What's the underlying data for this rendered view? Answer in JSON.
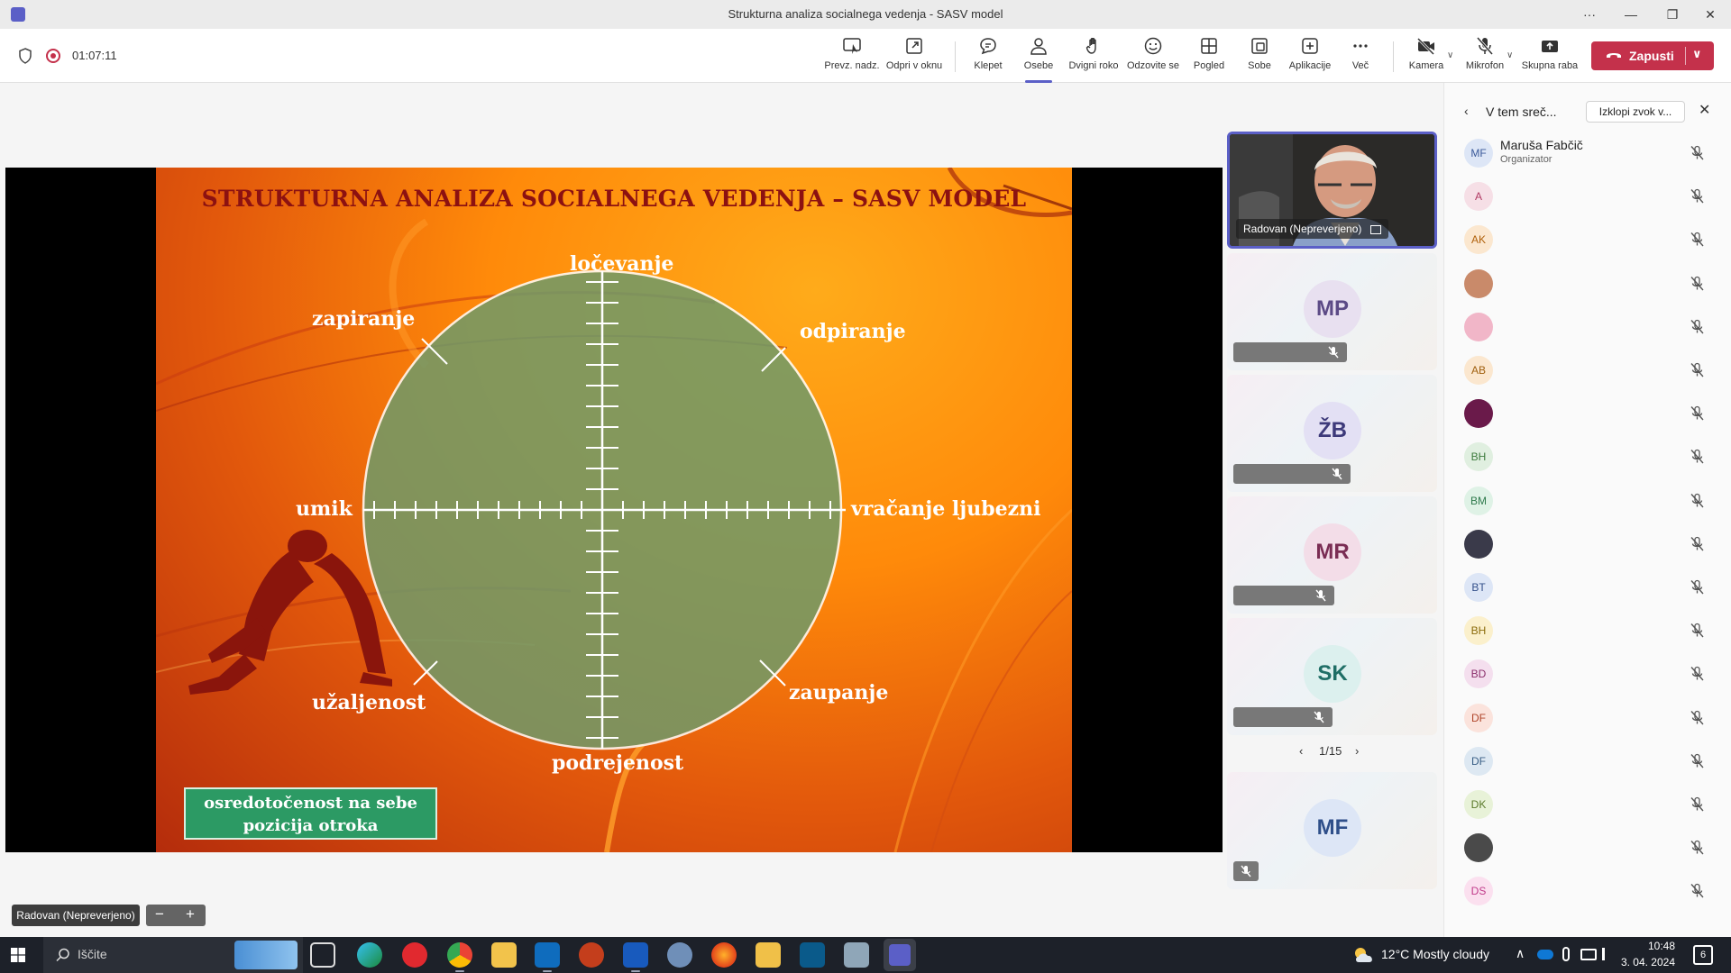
{
  "window": {
    "title": "Strukturna analiza socialnega vedenja - SASV model",
    "more": "···",
    "minimize": "—",
    "restore": "❐",
    "close": "✕"
  },
  "toolbar": {
    "timer": "01:07:11",
    "buttons": [
      {
        "label": "Prevz. nadz.",
        "icon": "take-control-icon"
      },
      {
        "label": "Odpri v oknu",
        "icon": "popout-icon"
      },
      {
        "label": "Klepet",
        "icon": "chat-icon"
      },
      {
        "label": "Osebe",
        "icon": "people-icon"
      },
      {
        "label": "Dvigni roko",
        "icon": "raise-hand-icon"
      },
      {
        "label": "Odzovite se",
        "icon": "react-icon"
      },
      {
        "label": "Pogled",
        "icon": "view-icon"
      },
      {
        "label": "Sobe",
        "icon": "rooms-icon"
      },
      {
        "label": "Aplikacije",
        "icon": "apps-icon"
      },
      {
        "label": "Več",
        "icon": "more-icon"
      },
      {
        "label": "Kamera",
        "icon": "camera-off-icon"
      },
      {
        "label": "Mikrofon",
        "icon": "mic-off-icon"
      },
      {
        "label": "Skupna raba",
        "icon": "share-icon"
      }
    ],
    "leave_label": "Zapusti",
    "accent_color": "#5b5fc7",
    "leave_color": "#c4314b"
  },
  "slide": {
    "title": "STRUKTURNA ANALIZA SOCIALNEGA VEDENJA – SASV MODEL",
    "labels": {
      "top": "ločevanje",
      "top_left": "zapiranje",
      "top_right": "odpiranje",
      "left": "umik",
      "right": "vračanje ljubezni",
      "bottom_left": "užaljenost",
      "bottom_right": "zaupanje",
      "bottom": "podrejenost"
    },
    "box_line1": "osredotočenost na sebe",
    "box_line2": "pozicija otroka"
  },
  "presenter": {
    "label": "Radovan (Nepreverjeno)",
    "zoom_out": "−",
    "zoom_in": "+"
  },
  "tiles": [
    {
      "type": "video",
      "name": "Radovan (Nepreverjeno)"
    },
    {
      "type": "avatar",
      "initials": "MP",
      "bg": "#e8e0f0",
      "fg": "#5c4a86"
    },
    {
      "type": "avatar",
      "initials": "ŽB",
      "bg": "#e3e0f4",
      "fg": "#3d3a7a"
    },
    {
      "type": "avatar",
      "initials": "MR",
      "bg": "#f3dde8",
      "fg": "#7a2d54"
    },
    {
      "type": "avatar",
      "initials": "SK",
      "bg": "#dcf0ee",
      "fg": "#1f6e66"
    },
    {
      "type": "avatar",
      "initials": "MF",
      "bg": "#dde6f6",
      "fg": "#2f4f8a"
    }
  ],
  "pager": {
    "text": "1/15",
    "prev": "‹",
    "next": "›"
  },
  "panel": {
    "title": "V tem sreč...",
    "mute_all": "Izklopi zvok v...",
    "back": "‹",
    "close": "✕",
    "participants": [
      {
        "initials": "MF",
        "name": "Maruša Fabčič",
        "role": "Organizator",
        "bg": "#dde6f6",
        "fg": "#3a5a9a"
      },
      {
        "initials": "A",
        "name": "",
        "role": "",
        "bg": "#f6dfe6",
        "fg": "#b03a63"
      },
      {
        "initials": "AK",
        "name": "",
        "role": "",
        "bg": "#fbe7cf",
        "fg": "#b0610b"
      },
      {
        "initials": "",
        "name": "",
        "role": "",
        "bg": "#c98a6a",
        "fg": "#fff",
        "photo": true
      },
      {
        "initials": "",
        "name": "",
        "role": "",
        "bg": "#f1b6c8",
        "fg": "#fff",
        "photo": true
      },
      {
        "initials": "AB",
        "name": "",
        "role": "",
        "bg": "#fbe7cf",
        "fg": "#a0600f"
      },
      {
        "initials": "",
        "name": "",
        "role": "",
        "bg": "#6a1a4a",
        "fg": "#fff",
        "photo": true
      },
      {
        "initials": "BH",
        "name": "",
        "role": "",
        "bg": "#e0efe0",
        "fg": "#3c7a3c"
      },
      {
        "initials": "BM",
        "name": "",
        "role": "",
        "bg": "#dff2e6",
        "fg": "#2e7a4c"
      },
      {
        "initials": "",
        "name": "",
        "role": "",
        "bg": "#3a3a4a",
        "fg": "#fff",
        "photo": true
      },
      {
        "initials": "BT",
        "name": "",
        "role": "",
        "bg": "#dde6f6",
        "fg": "#34508a"
      },
      {
        "initials": "BH",
        "name": "",
        "role": "",
        "bg": "#fbf0cc",
        "fg": "#8a6a0a"
      },
      {
        "initials": "BD",
        "name": "",
        "role": "",
        "bg": "#f4dfee",
        "fg": "#8a2d6a"
      },
      {
        "initials": "DF",
        "name": "",
        "role": "",
        "bg": "#fbe3dc",
        "fg": "#b0452a"
      },
      {
        "initials": "DF",
        "name": "",
        "role": "",
        "bg": "#dde8f2",
        "fg": "#3a5f86"
      },
      {
        "initials": "DK",
        "name": "",
        "role": "",
        "bg": "#e8f2d8",
        "fg": "#5a7a2a"
      },
      {
        "initials": "",
        "name": "",
        "role": "",
        "bg": "#4a4a4a",
        "fg": "#fff",
        "photo": true
      },
      {
        "initials": "DS",
        "name": "",
        "role": "",
        "bg": "#fbe0ef",
        "fg": "#c03a8a"
      }
    ]
  },
  "taskbar": {
    "search_placeholder": "Iščite",
    "weather": "12°C  Mostly cloudy",
    "time": "10:48",
    "date": "3. 04. 2024",
    "notifications": "6"
  }
}
